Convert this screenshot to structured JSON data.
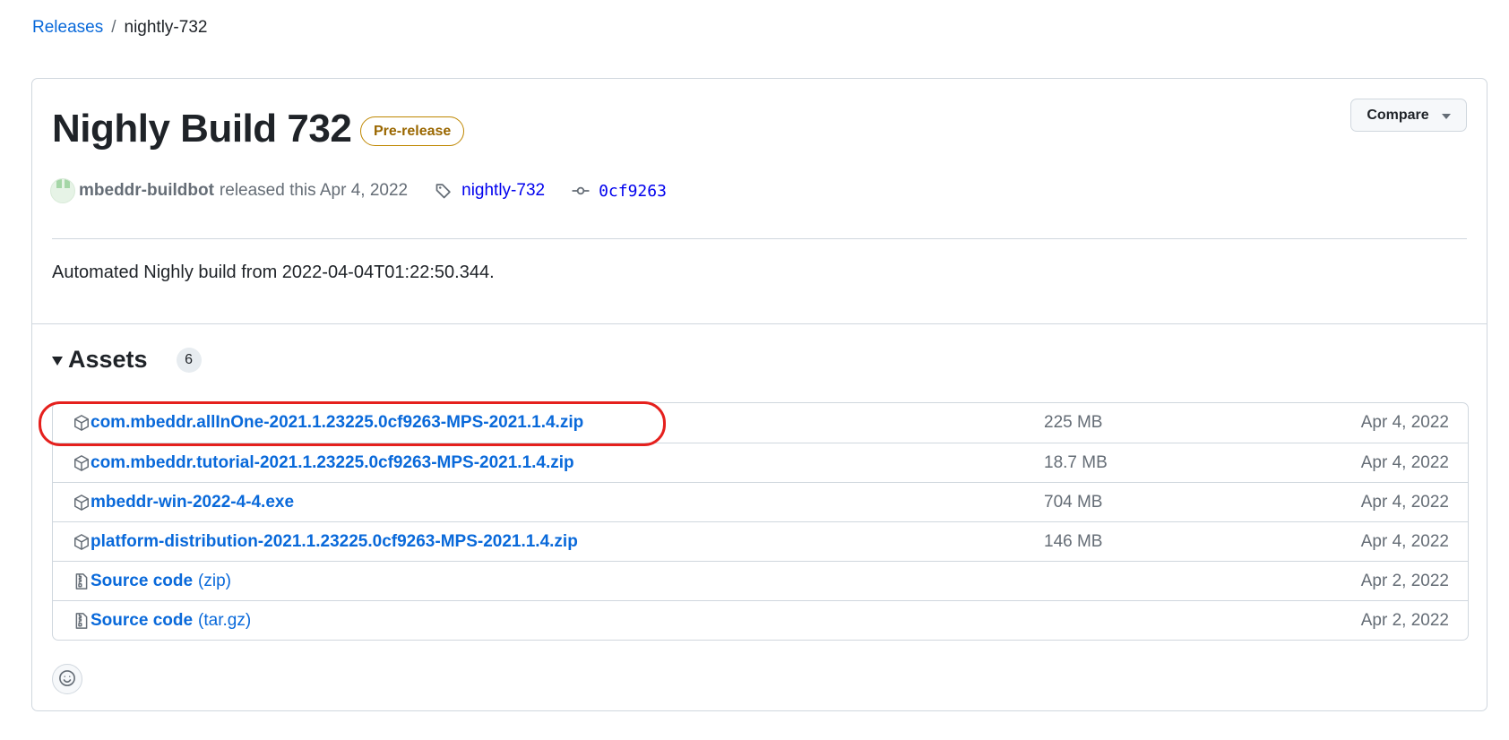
{
  "breadcrumb": {
    "releases_label": "Releases",
    "separator": "/",
    "current": "nightly-732"
  },
  "release": {
    "title": "Nighly Build 732",
    "badge": "Pre-release",
    "compare_label": "Compare",
    "author": "mbeddr-buildbot",
    "released_text": "released this Apr 4, 2022",
    "tag": "nightly-732",
    "commit": "0cf9263",
    "description": "Automated Nighly build from 2022-04-04T01:22:50.344."
  },
  "assets": {
    "title": "Assets",
    "count": "6",
    "items": [
      {
        "name": "com.mbeddr.allInOne-2021.1.23225.0cf9263-MPS-2021.1.4.zip",
        "suffix": "",
        "size": "225 MB",
        "date": "Apr 4, 2022",
        "icon": "package-icon"
      },
      {
        "name": "com.mbeddr.tutorial-2021.1.23225.0cf9263-MPS-2021.1.4.zip",
        "suffix": "",
        "size": "18.7 MB",
        "date": "Apr 4, 2022",
        "icon": "package-icon"
      },
      {
        "name": "mbeddr-win-2022-4-4.exe",
        "suffix": "",
        "size": "704 MB",
        "date": "Apr 4, 2022",
        "icon": "package-icon"
      },
      {
        "name": "platform-distribution-2021.1.23225.0cf9263-MPS-2021.1.4.zip",
        "suffix": "",
        "size": "146 MB",
        "date": "Apr 4, 2022",
        "icon": "package-icon"
      },
      {
        "name": "Source code",
        "suffix": "(zip)",
        "size": "",
        "date": "Apr 2, 2022",
        "icon": "file-zip-icon"
      },
      {
        "name": "Source code",
        "suffix": "(tar.gz)",
        "size": "",
        "date": "Apr 2, 2022",
        "icon": "file-zip-icon"
      }
    ]
  },
  "colors": {
    "link": "#0969da",
    "highlight": "#e5201d",
    "prerelease": "#9a6700"
  }
}
